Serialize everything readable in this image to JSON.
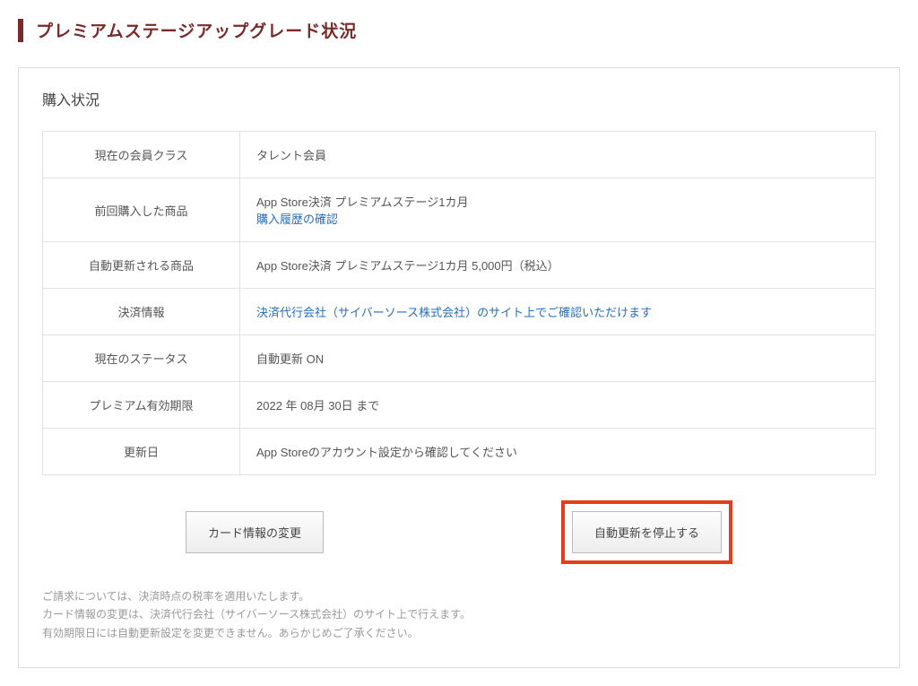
{
  "page": {
    "title": "プレミアムステージアップグレード状況"
  },
  "section": {
    "title": "購入状況"
  },
  "rows": {
    "member_class": {
      "label": "現在の会員クラス",
      "value": "タレント会員"
    },
    "last_purchase": {
      "label": "前回購入した商品",
      "value": "App Store決済 プレミアムステージ1カ月",
      "link_text": "購入履歴の確認"
    },
    "auto_renew_item": {
      "label": "自動更新される商品",
      "value": "App Store決済 プレミアムステージ1カ月 5,000円（税込）"
    },
    "payment_info": {
      "label": "決済情報",
      "link_text": "決済代行会社（サイバーソース株式会社）のサイト上でご確認いただけます"
    },
    "status": {
      "label": "現在のステータス",
      "value": "自動更新 ON"
    },
    "expiry": {
      "label": "プレミアム有効期限",
      "value": "2022 年 08月 30日 まで"
    },
    "renewal": {
      "label": "更新日",
      "value": "App Storeのアカウント設定から確認してください"
    }
  },
  "buttons": {
    "change_card": "カード情報の変更",
    "stop_auto_renew": "自動更新を停止する"
  },
  "notes": {
    "line1": "ご請求については、決済時点の税率を適用いたします。",
    "line2": "カード情報の変更は、決済代行会社（サイバーソース株式会社）のサイト上で行えます。",
    "line3": "有効期限日には自動更新設定を変更できません。あらかじめご了承ください。"
  }
}
